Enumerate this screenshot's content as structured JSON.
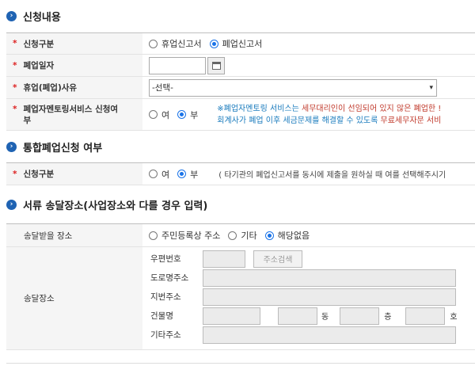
{
  "section1": {
    "title": "신청내용",
    "rows": {
      "type": {
        "label": "신청구분",
        "options": [
          "휴업신고서",
          "폐업신고서"
        ],
        "selected": 1
      },
      "date": {
        "label": "폐업일자",
        "value": ""
      },
      "reason": {
        "label": "휴업(폐업)사유",
        "selected": "-선택-"
      },
      "mentor": {
        "label_line1": "폐업자멘토링서비스 신청여",
        "label_line2": "부",
        "options": [
          "여",
          "부"
        ],
        "selected": 1,
        "notice_line1_a": "※폐업자멘토링 서비스는 ",
        "notice_line1_b": "세무대리인이 선임되어 있지 않은 폐업한 !",
        "notice_line2_a": "회계사가 폐업 이후 세금문제를 해결할 수 있도록 ",
        "notice_line2_b": "무료세무자문 서비"
      }
    }
  },
  "section2": {
    "title": "통합폐업신청 여부",
    "rows": {
      "type": {
        "label": "신청구분",
        "options": [
          "여",
          "부"
        ],
        "selected": 1,
        "hint": "( 타기관의 폐업신고서를 동시에 제출을 원하실 때 여를 선택해주시기"
      }
    }
  },
  "section3": {
    "title": "서류 송달장소(사업장소와 다를 경우 입력)",
    "receive": {
      "label": "송달받을 장소",
      "options": [
        "주민등록상 주소",
        "기타",
        "해당없음"
      ],
      "selected": 2
    },
    "place": {
      "label": "송달장소",
      "postal_label": "우편번호",
      "search_button": "주소검색",
      "road_label": "도로명주소",
      "lot_label": "지번주소",
      "building_label": "건물명",
      "dong_unit": "동",
      "floor_unit": "층",
      "ho_unit": "호",
      "etc_label": "기타주소"
    }
  },
  "colors": {
    "accent": "#1f63b3",
    "required": "#dd2222",
    "notice_blue": "#1a7bbd",
    "notice_red": "#c0392b"
  }
}
